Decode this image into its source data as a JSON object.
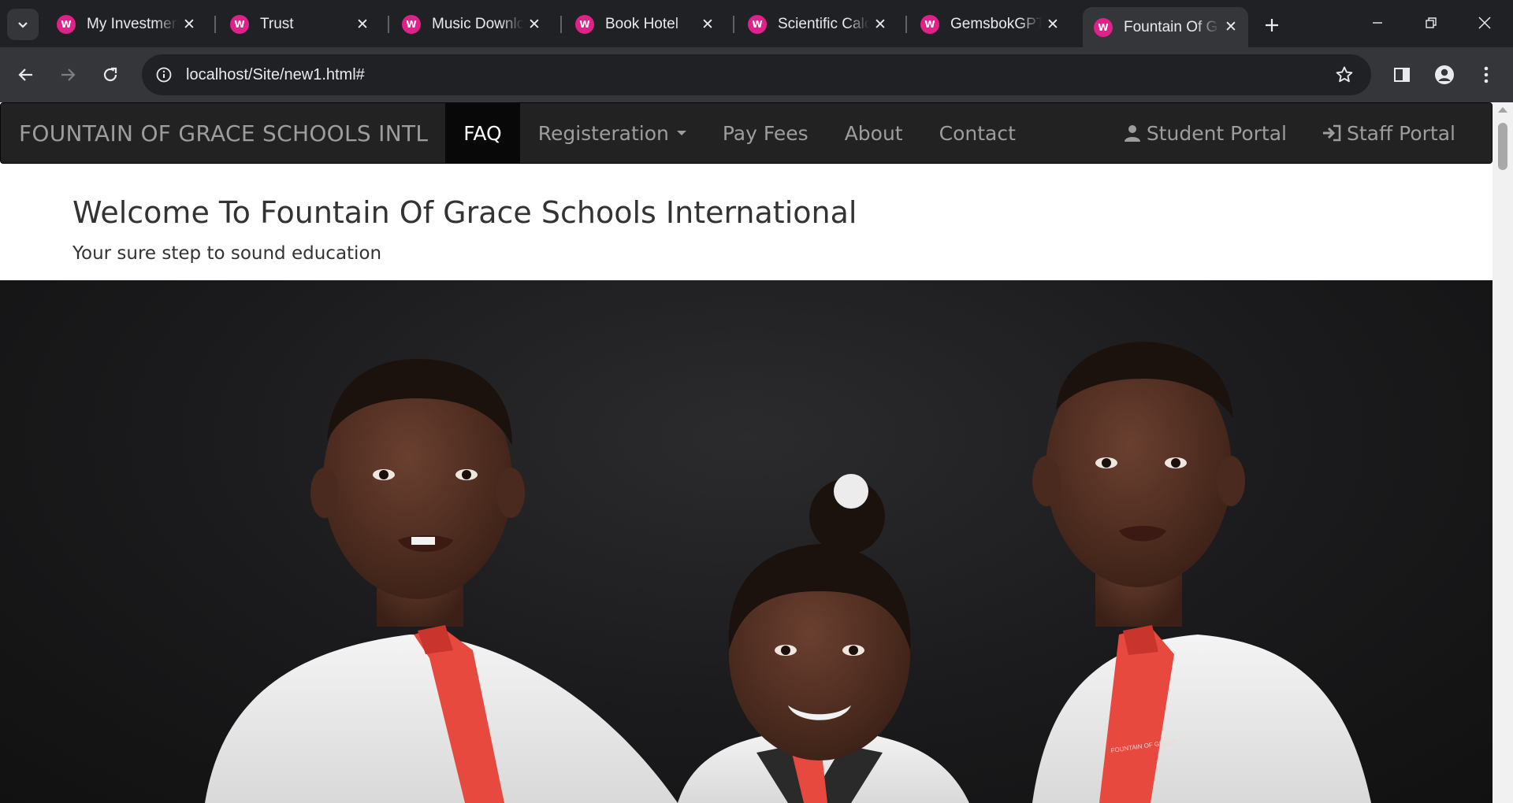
{
  "browser": {
    "tabs": [
      {
        "title": "My Investmen",
        "active": false
      },
      {
        "title": "Trust",
        "active": false
      },
      {
        "title": "Music Downlo",
        "active": false
      },
      {
        "title": "Book Hotel",
        "active": false
      },
      {
        "title": "Scientific Calc",
        "active": false
      },
      {
        "title": "GemsbokGPT",
        "active": false
      },
      {
        "title": "Fountain Of G",
        "active": true
      }
    ],
    "url": "localhost/Site/new1.html#",
    "favicon_color": "#e0218a"
  },
  "site": {
    "brand": "FOUNTAIN OF GRACE SCHOOLS INTL",
    "nav": {
      "faq": "FAQ",
      "registration": "Registeration",
      "pay_fees": "Pay Fees",
      "about": "About",
      "contact": "Contact",
      "student_portal": "Student Portal",
      "staff_portal": "Staff Portal"
    },
    "heading": "Welcome To Fountain Of Grace Schools International",
    "tagline": "Your sure step to sound education",
    "tie_text": "FOUNTAIN OF GRACE"
  }
}
